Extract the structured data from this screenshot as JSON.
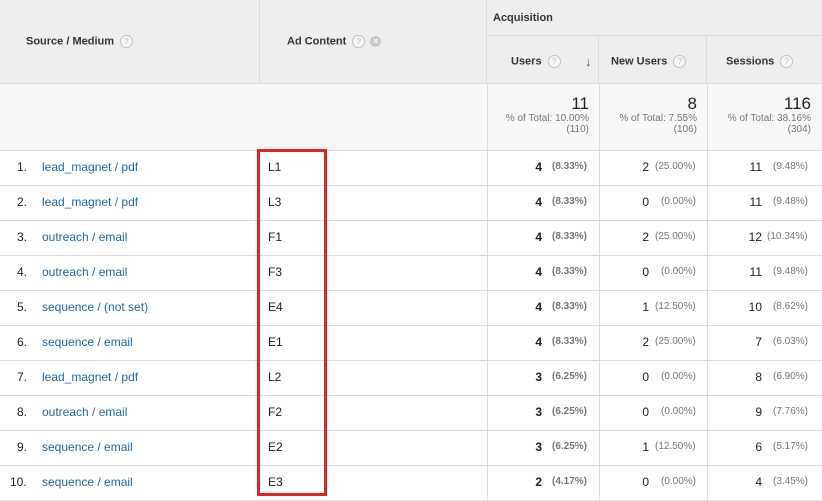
{
  "header": {
    "source_medium": "Source / Medium",
    "ad_content": "Ad Content",
    "acquisition": "Acquisition",
    "users": "Users",
    "new_users": "New Users",
    "sessions": "Sessions",
    "help_glyph": "?",
    "remove_glyph": "×",
    "sort_glyph": "↓"
  },
  "totals": {
    "users": {
      "value": "11",
      "pct": "% of Total: 10.00%",
      "of": "(110)"
    },
    "new_users": {
      "value": "8",
      "pct": "% of Total: 7.55%",
      "of": "(106)"
    },
    "sessions": {
      "value": "116",
      "pct": "% of Total: 38.16%",
      "of": "(304)"
    }
  },
  "rows": [
    {
      "n": "1.",
      "src": "lead_magnet / pdf",
      "ad": "L1",
      "users": "4",
      "users_pct": "(8.33%)",
      "new": "2",
      "new_pct": "(25.00%)",
      "sess": "11",
      "sess_pct": "(9.48%)"
    },
    {
      "n": "2.",
      "src": "lead_magnet / pdf",
      "ad": "L3",
      "users": "4",
      "users_pct": "(8.33%)",
      "new": "0",
      "new_pct": "(0.00%)",
      "sess": "11",
      "sess_pct": "(9.48%)"
    },
    {
      "n": "3.",
      "src": "outreach / email",
      "ad": "F1",
      "users": "4",
      "users_pct": "(8.33%)",
      "new": "2",
      "new_pct": "(25.00%)",
      "sess": "12",
      "sess_pct": "(10.34%)"
    },
    {
      "n": "4.",
      "src": "outreach / email",
      "ad": "F3",
      "users": "4",
      "users_pct": "(8.33%)",
      "new": "0",
      "new_pct": "(0.00%)",
      "sess": "11",
      "sess_pct": "(9.48%)"
    },
    {
      "n": "5.",
      "src": "sequence / (not set)",
      "ad": "E4",
      "users": "4",
      "users_pct": "(8.33%)",
      "new": "1",
      "new_pct": "(12.50%)",
      "sess": "10",
      "sess_pct": "(8.62%)"
    },
    {
      "n": "6.",
      "src": "sequence / email",
      "ad": "E1",
      "users": "4",
      "users_pct": "(8.33%)",
      "new": "2",
      "new_pct": "(25.00%)",
      "sess": "7",
      "sess_pct": "(6.03%)"
    },
    {
      "n": "7.",
      "src": "lead_magnet / pdf",
      "ad": "L2",
      "users": "3",
      "users_pct": "(6.25%)",
      "new": "0",
      "new_pct": "(0.00%)",
      "sess": "8",
      "sess_pct": "(6.90%)"
    },
    {
      "n": "8.",
      "src": "outreach / email",
      "ad": "F2",
      "users": "3",
      "users_pct": "(6.25%)",
      "new": "0",
      "new_pct": "(0.00%)",
      "sess": "9",
      "sess_pct": "(7.76%)"
    },
    {
      "n": "9.",
      "src": "sequence / email",
      "ad": "E2",
      "users": "3",
      "users_pct": "(6.25%)",
      "new": "1",
      "new_pct": "(12.50%)",
      "sess": "6",
      "sess_pct": "(5.17%)"
    },
    {
      "n": "10.",
      "src": "sequence / email",
      "ad": "E3",
      "users": "2",
      "users_pct": "(4.17%)",
      "new": "0",
      "new_pct": "(0.00%)",
      "sess": "4",
      "sess_pct": "(3.45%)"
    }
  ],
  "colors": {
    "link": "#1a6aa6",
    "highlight_box": "#e02424",
    "header_bg": "#eeeeee"
  }
}
